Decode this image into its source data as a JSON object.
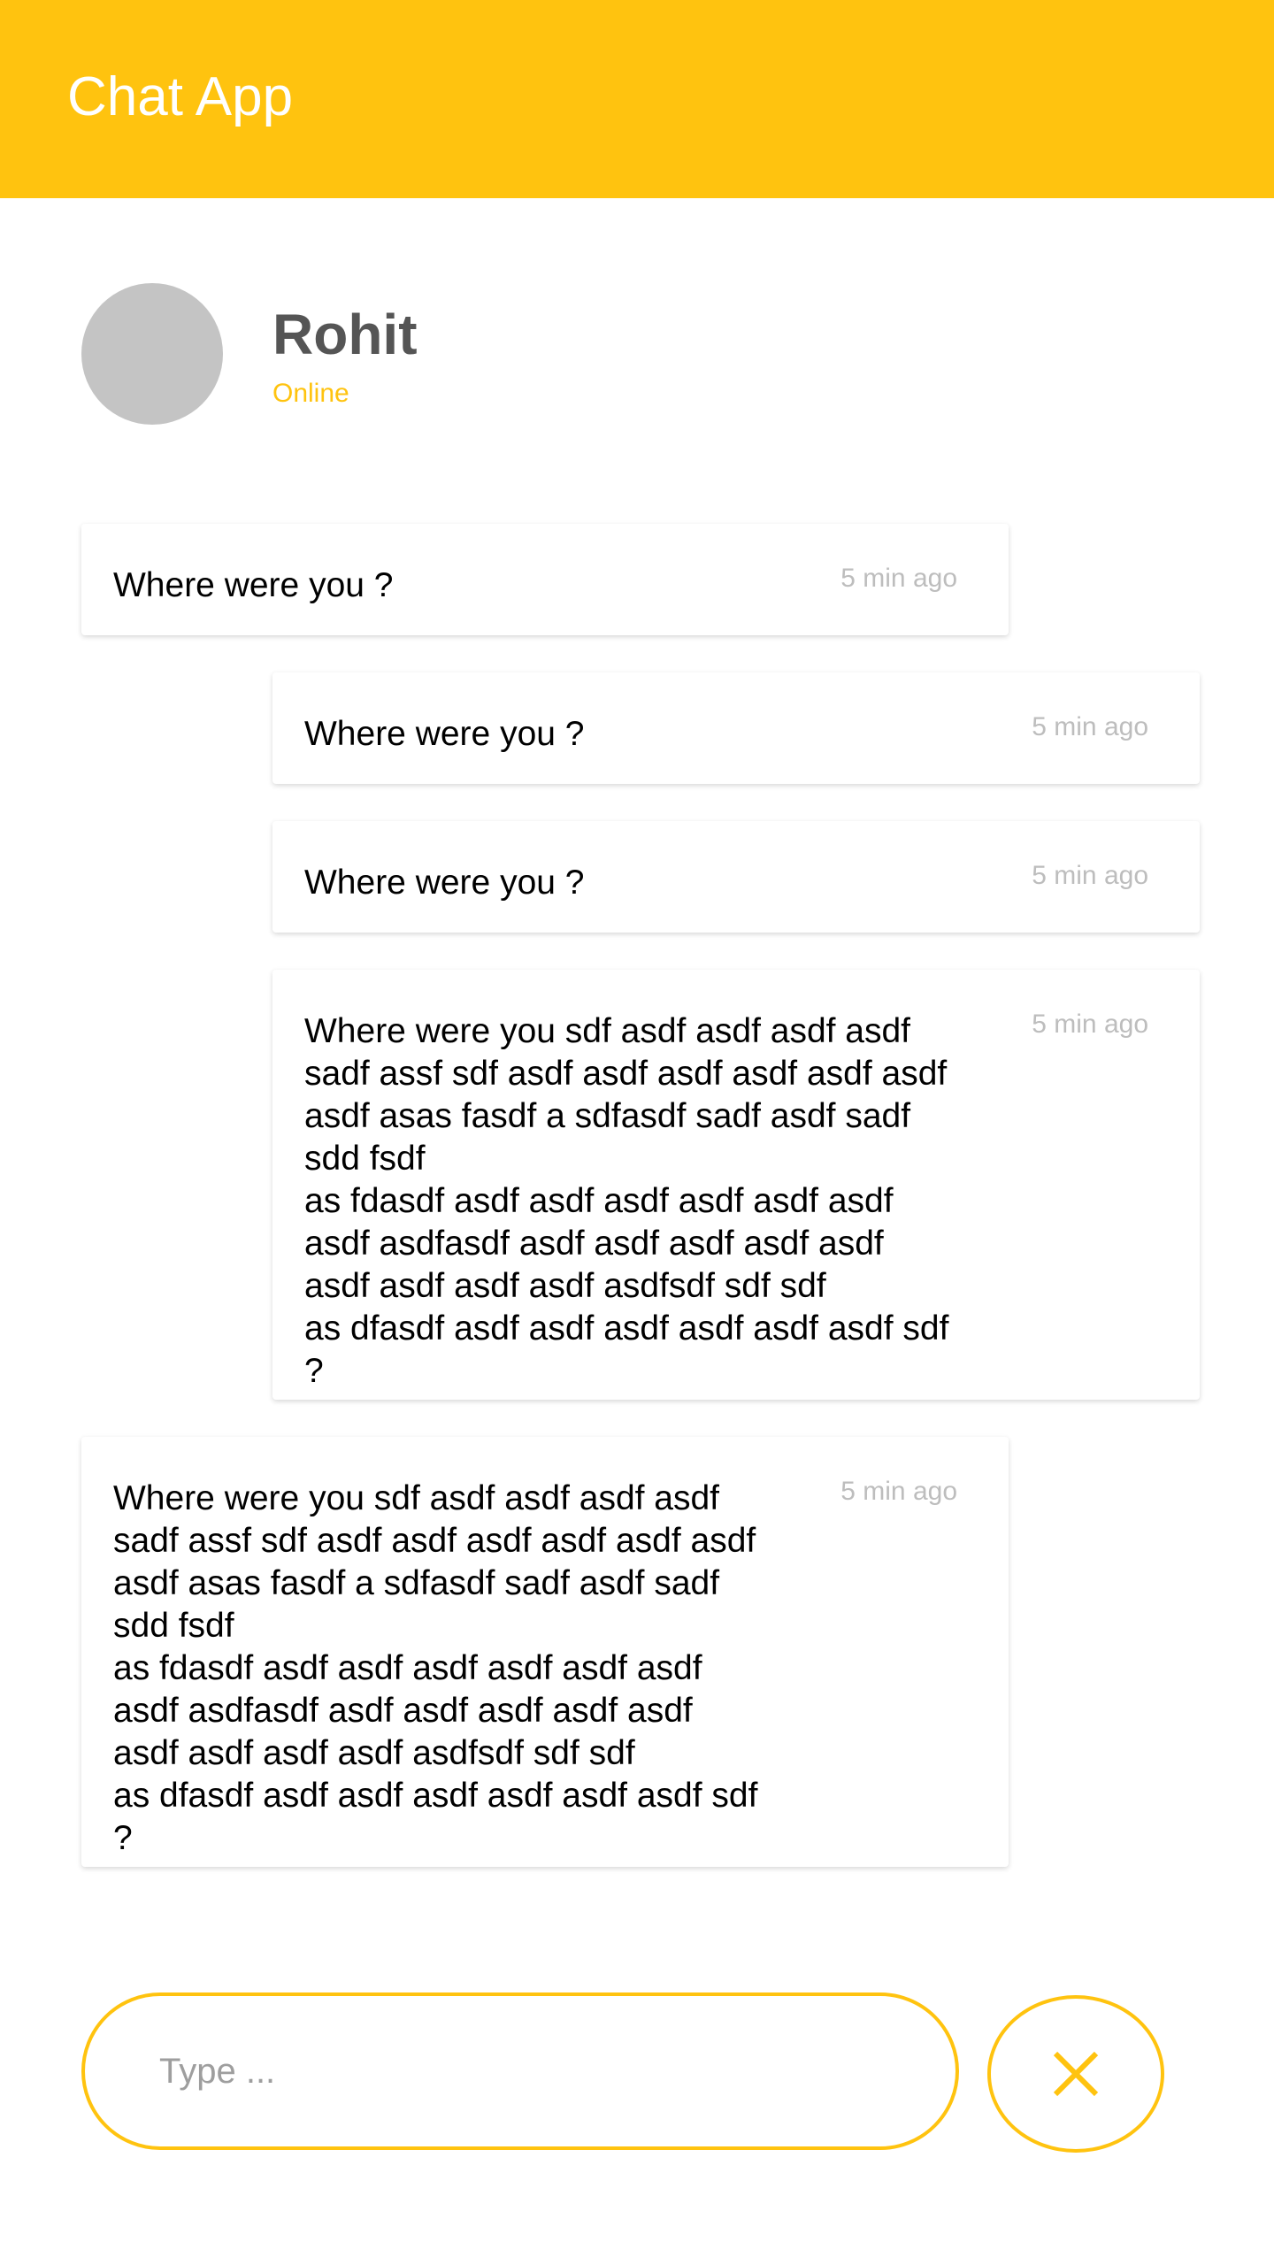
{
  "app_bar": {
    "title": "Chat App",
    "color": "#FFC30F"
  },
  "contact": {
    "name": "Rohit",
    "status": "Online"
  },
  "messages": [
    {
      "side": "left",
      "text": "Where were you ?",
      "time": "5 min ago"
    },
    {
      "side": "right",
      "text": "Where were you ?",
      "time": "5 min ago"
    },
    {
      "side": "right",
      "text": "Where were you ?",
      "time": "5 min ago"
    },
    {
      "side": "right",
      "text": "Where were you sdf asdf asdf asdf asdf\nsadf assf sdf asdf asdf asdf asdf asdf asdf\nasdf asas fasdf a sdfasdf sadf asdf sadf\nsdd fsdf\nas fdasdf asdf asdf asdf asdf asdf asdf\nasdf  asdfasdf asdf asdf asdf asdf asdf\nasdf asdf asdf asdf asdfsdf sdf sdf\nas dfasdf asdf asdf asdf asdf asdf asdf sdf\n?",
      "time": "5 min ago"
    },
    {
      "side": "left",
      "text": "Where were you sdf asdf asdf asdf asdf\nsadf assf sdf asdf asdf asdf asdf asdf asdf\nasdf asas fasdf a sdfasdf sadf asdf sadf\nsdd fsdf\nas fdasdf asdf asdf asdf asdf asdf asdf\nasdf  asdfasdf asdf asdf asdf asdf asdf\nasdf asdf asdf asdf asdfsdf sdf sdf\nas dfasdf asdf asdf asdf asdf asdf asdf sdf\n?",
      "time": "5 min ago"
    }
  ],
  "composer": {
    "placeholder": "Type ...",
    "value": "",
    "button_icon": "close-icon"
  }
}
